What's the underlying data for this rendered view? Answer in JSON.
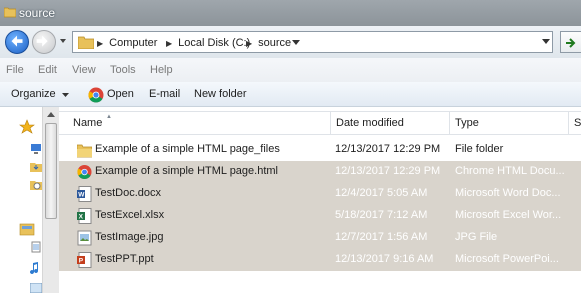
{
  "window": {
    "title": "source"
  },
  "address": {
    "crumbs": [
      "Computer",
      "Local Disk (C:)",
      "source"
    ]
  },
  "menu": {
    "items": [
      "File",
      "Edit",
      "View",
      "Tools",
      "Help"
    ]
  },
  "toolbar": {
    "organize": "Organize",
    "open": "Open",
    "email": "E-mail",
    "new_folder": "New folder"
  },
  "columns": {
    "name": "Name",
    "date": "Date modified",
    "type": "Type",
    "size": "S"
  },
  "files": [
    {
      "name": "Example of a simple HTML page_files",
      "date": "12/13/2017 12:29 PM",
      "type": "File folder",
      "icon": "folder-icon"
    },
    {
      "name": "Example of a simple HTML page.html",
      "date": "12/13/2017 12:29 PM",
      "type": "Chrome HTML Docu...",
      "icon": "chrome-html-icon"
    },
    {
      "name": "TestDoc.docx",
      "date": "12/4/2017 5:05 AM",
      "type": "Microsoft Word Doc...",
      "icon": "word-doc-icon"
    },
    {
      "name": "TestExcel.xlsx",
      "date": "5/18/2017 7:12 AM",
      "type": "Microsoft Excel Wor...",
      "icon": "excel-icon"
    },
    {
      "name": "TestImage.jpg",
      "date": "12/7/2017 1:56 AM",
      "type": "JPG File",
      "icon": "image-icon"
    },
    {
      "name": "TestPPT.ppt",
      "date": "12/13/2017 9:16 AM",
      "type": "Microsoft PowerPoi...",
      "icon": "powerpoint-icon"
    }
  ],
  "colors": {
    "selection": "#d9d4cc",
    "titlebar": "#959ca2",
    "accent": "#1b5fc4"
  }
}
